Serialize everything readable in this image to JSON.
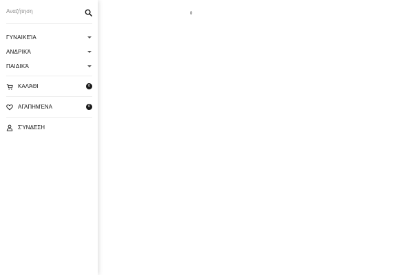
{
  "search": {
    "placeholder": "Αναζήτηση"
  },
  "categories": [
    {
      "label": "ΓΥΝΑΙΚΕΊΑ"
    },
    {
      "label": "ΑΝΔΡΙΚΆ"
    },
    {
      "label": "ΠΑΙΔΙΚΆ"
    }
  ],
  "actions": {
    "cart": {
      "label": "ΚΑΛΆΘΙ",
      "count": "0",
      "icon": "cart-icon"
    },
    "wishlist": {
      "label": "ΑΓΑΠΗΜΈΝΑ",
      "count": "0",
      "icon": "heart-icon"
    },
    "login": {
      "label": "ΣΎΝΔΕΣΗ",
      "icon": "user-icon"
    }
  },
  "content": {
    "counter": "0"
  },
  "colors": {
    "badge": "#1a1a1a",
    "divider": "#ececec",
    "text": "#111111"
  }
}
